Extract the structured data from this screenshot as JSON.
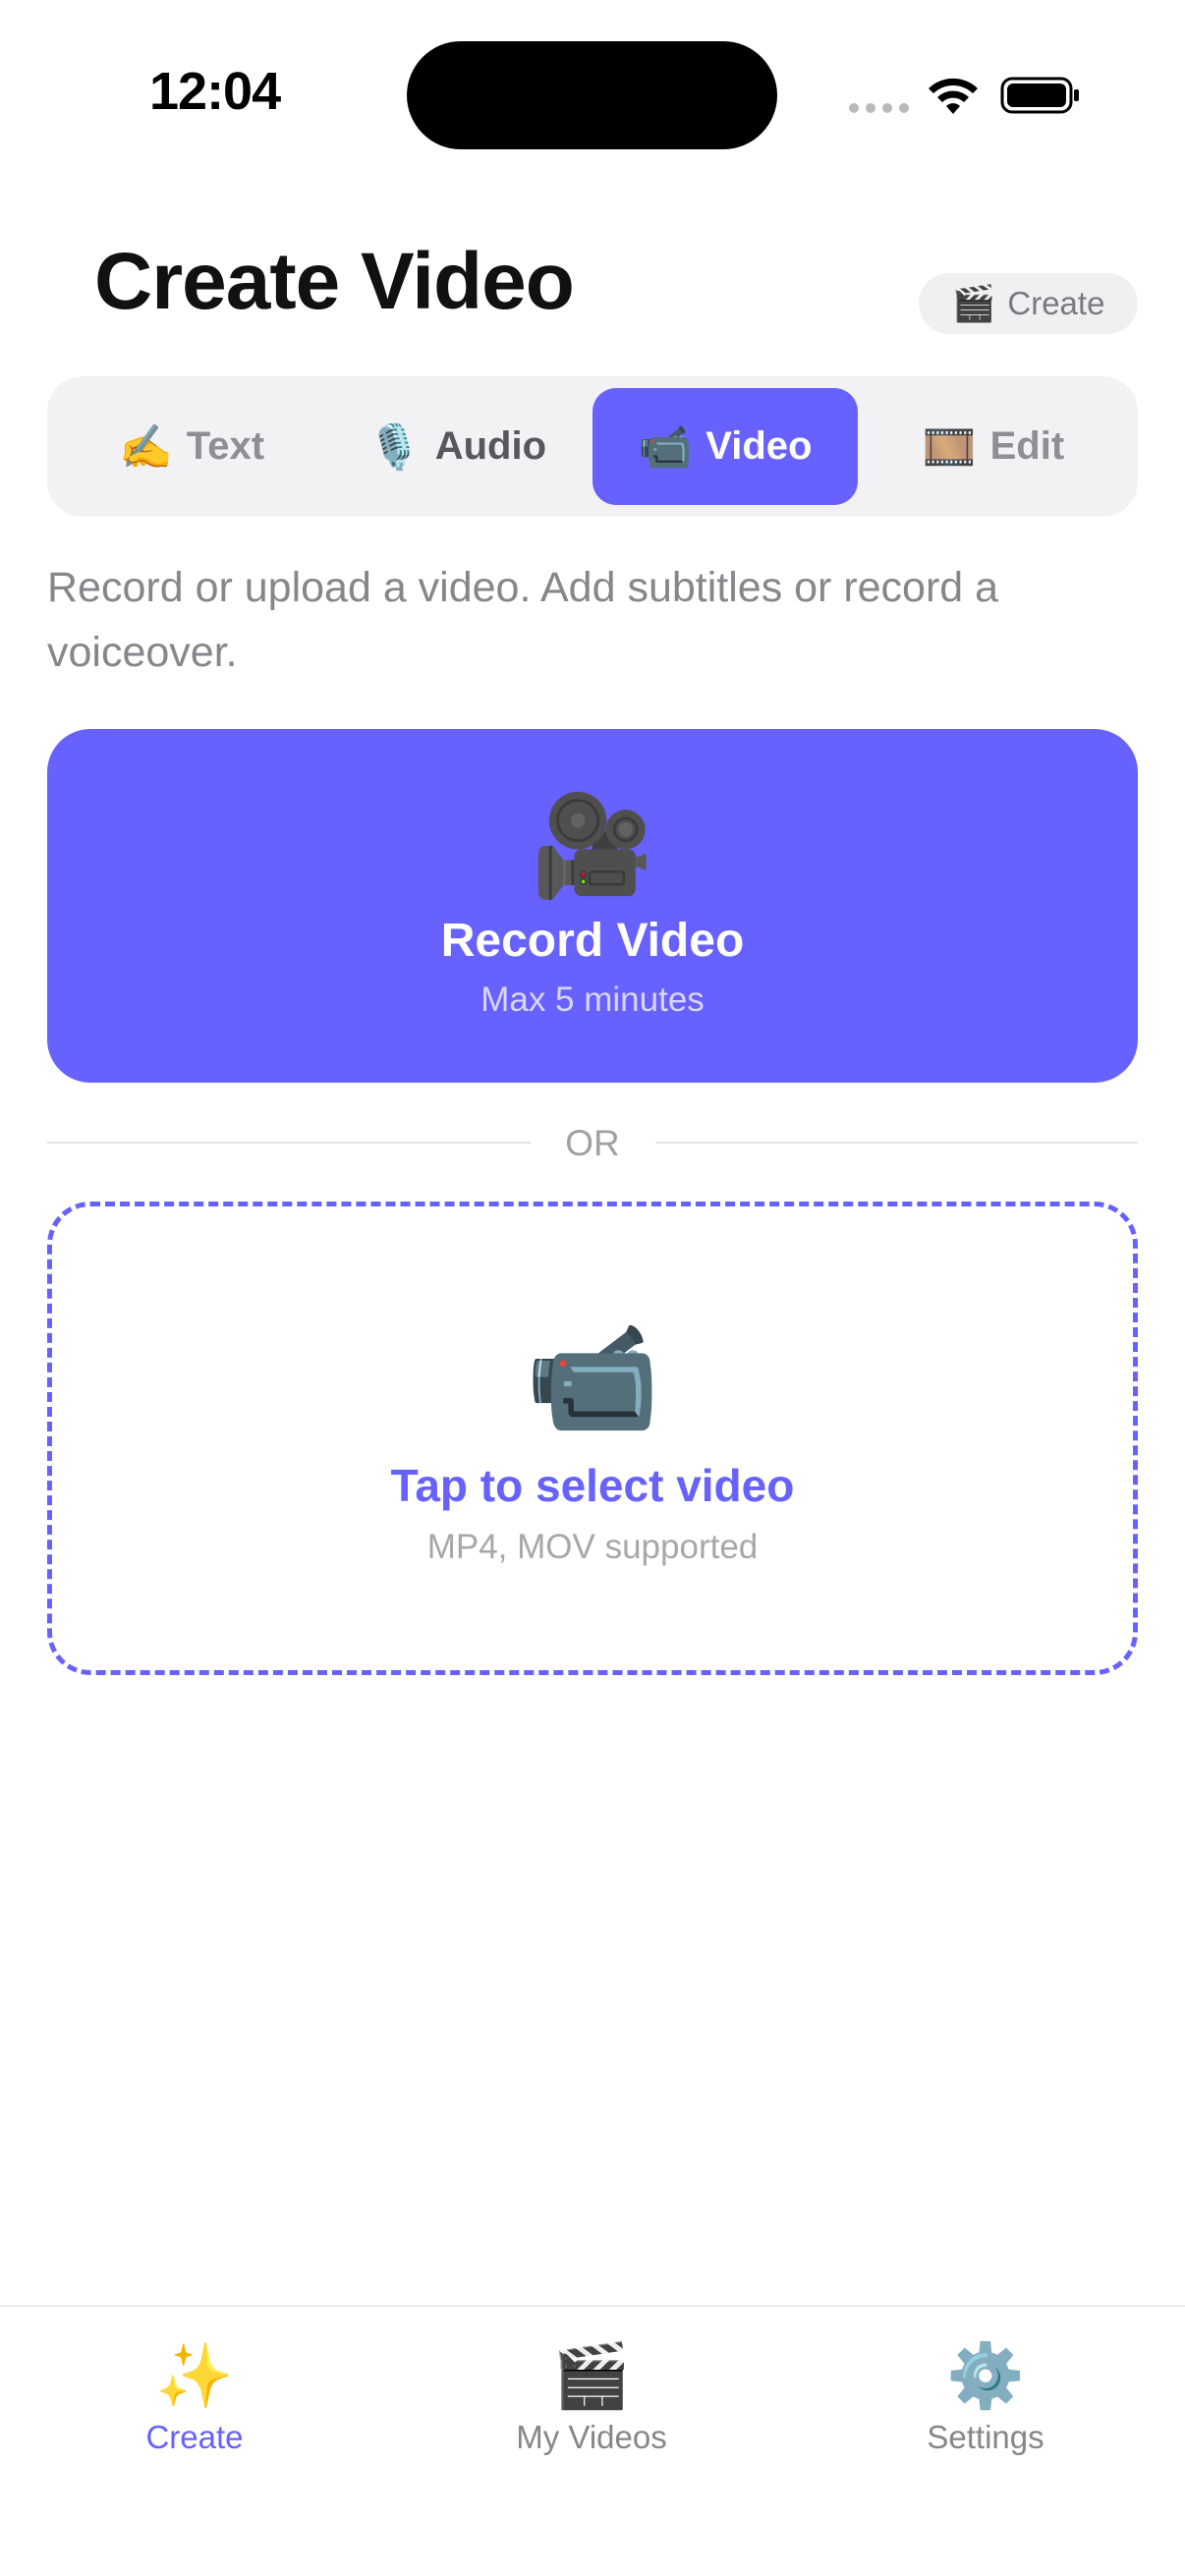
{
  "status_bar": {
    "time": "12:04"
  },
  "header": {
    "title": "Create Video",
    "pill": {
      "icon": "🎬",
      "label": "Create"
    }
  },
  "segments": [
    {
      "icon": "✍️",
      "label": "Text",
      "active": false
    },
    {
      "icon": "🎙️",
      "label": "Audio",
      "active": false
    },
    {
      "icon": "📹",
      "label": "Video",
      "active": true
    },
    {
      "icon": "🎞️",
      "label": "Edit",
      "active": false
    }
  ],
  "description": "Record or upload a video. Add subtitles or record a voiceover.",
  "record_card": {
    "icon": "🎥",
    "title": "Record Video",
    "subtitle": "Max 5 minutes"
  },
  "divider": {
    "label": "OR"
  },
  "upload_card": {
    "icon": "📹",
    "title": "Tap to select video",
    "subtitle": "MP4, MOV supported"
  },
  "tab_bar": [
    {
      "icon": "✨",
      "label": "Create",
      "active": true
    },
    {
      "icon": "🎬",
      "label": "My Videos",
      "active": false
    },
    {
      "icon": "⚙️",
      "label": "Settings",
      "active": false
    }
  ],
  "colors": {
    "accent": "#6762ff",
    "muted": "#86868b",
    "segment_bg": "#f2f2f4"
  }
}
